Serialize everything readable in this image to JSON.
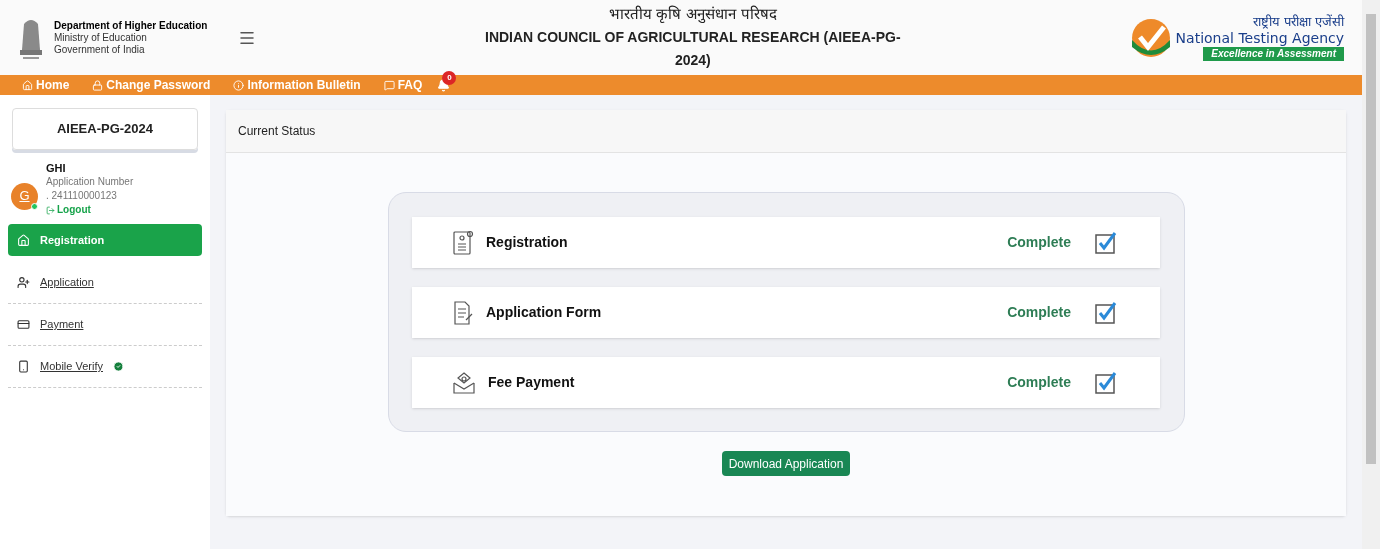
{
  "header": {
    "dept_lines": [
      "Department of Higher Education",
      "Ministry of Education",
      "Government of India"
    ],
    "title_hindi": "भारतीय कृषि अनुसंधान परिषद",
    "title": "INDIAN COUNCIL OF AGRICULTURAL RESEARCH (AIEEA-PG-2024)",
    "agency_hindi": "राष्ट्रीय परीक्षा एजेंसी",
    "agency": "National Testing Agency",
    "agency_tagline": "Excellence in Assessment"
  },
  "nav": [
    {
      "label": "Home",
      "kind": "home"
    },
    {
      "label": "Change Password",
      "kind": "lock"
    },
    {
      "label": "Information Bulletin",
      "kind": "info"
    },
    {
      "label": "FAQ",
      "kind": "chat"
    }
  ],
  "notifications": {
    "count": "0"
  },
  "sidebar": {
    "exam": "AIEEA-PG-2024",
    "user": {
      "initial": "G",
      "name": "GHI",
      "number_label": "Application Number",
      "number": ". 241110000123",
      "online": true
    },
    "logout": "Logout",
    "items": [
      {
        "label": "Registration",
        "kind": "home",
        "selected": true,
        "verified": false
      },
      {
        "label": "Application",
        "kind": "user",
        "selected": false,
        "verified": false
      },
      {
        "label": "Payment",
        "kind": "payment",
        "selected": false,
        "verified": false
      },
      {
        "label": "Mobile Verify",
        "kind": "mobile",
        "selected": false,
        "verified": true
      }
    ]
  },
  "main": {
    "title": "Current Status",
    "steps": [
      {
        "label": "Registration",
        "kind": "registration",
        "status": "Complete",
        "checked": true
      },
      {
        "label": "Application Form",
        "kind": "form",
        "status": "Complete",
        "checked": true
      },
      {
        "label": "Fee Payment",
        "kind": "fee",
        "status": "Complete",
        "checked": true
      }
    ],
    "download": "Download Application"
  }
}
